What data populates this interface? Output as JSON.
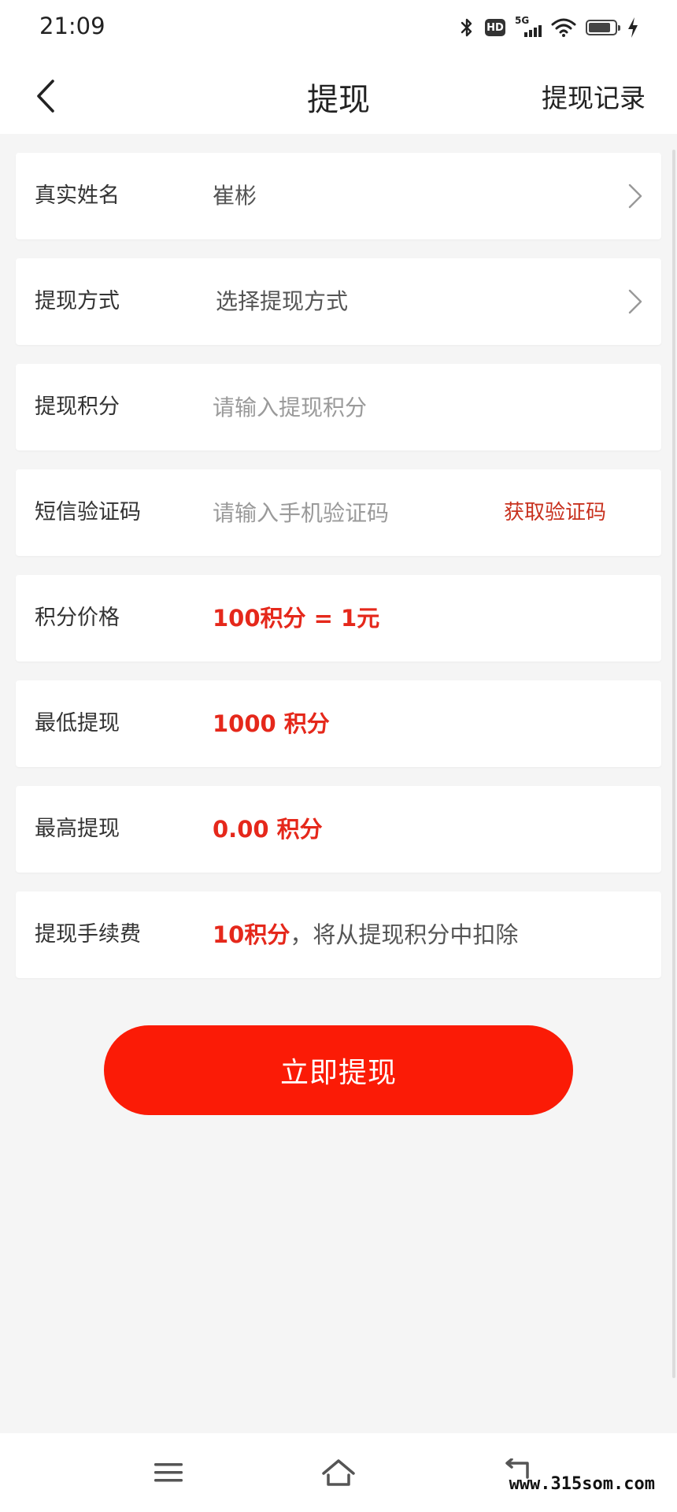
{
  "status_bar": {
    "time": "21:09",
    "hd_label": "HD",
    "network_label": "5G",
    "battery_level": 0.85,
    "icons": [
      "bluetooth-icon",
      "hd-icon",
      "signal-icon",
      "wifi-icon",
      "battery-icon",
      "charging-icon"
    ]
  },
  "nav": {
    "back_icon": "chevron-left-icon",
    "title": "提现",
    "right_link": "提现记录"
  },
  "form": {
    "real_name": {
      "label": "真实姓名",
      "value": "崔彬"
    },
    "method": {
      "label": "提现方式",
      "value": "选择提现方式"
    },
    "points": {
      "label": "提现积分",
      "placeholder": "请输入提现积分",
      "value": ""
    },
    "sms": {
      "label": "短信验证码",
      "placeholder": "请输入手机验证码",
      "value": "",
      "button": "获取验证码"
    },
    "price": {
      "label": "积分价格",
      "value": "100积分 = 1元"
    },
    "min": {
      "label": "最低提现",
      "value": "1000 积分"
    },
    "max": {
      "label": "最高提现",
      "value": "0.00 积分"
    },
    "fee": {
      "label": "提现手续费",
      "amount": "10积分",
      "note": "，将从提现积分中扣除"
    }
  },
  "submit_label": "立即提现",
  "system_nav": {
    "icons": [
      "menu-icon",
      "home-icon",
      "back-icon"
    ]
  },
  "watermark": "www.315som.com",
  "colors": {
    "accent": "#fb1b06",
    "highlight_text": "#e5281b",
    "background": "#f5f5f5"
  }
}
